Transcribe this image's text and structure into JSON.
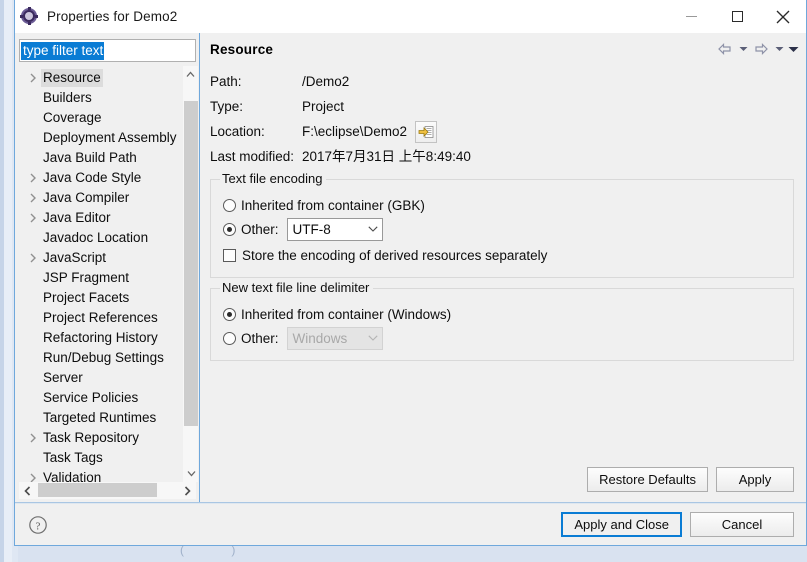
{
  "window": {
    "title": "Properties for Demo2",
    "icon": "properties-gear-icon",
    "controls": {
      "minimize": "minimize-icon",
      "maximize": "maximize-icon",
      "close": "close-icon"
    }
  },
  "background": {
    "faint_text": "( )"
  },
  "filter": {
    "value": "type filter text",
    "placeholder": "type filter text",
    "selected": true,
    "selection_color": "#0a7cd4"
  },
  "tree": {
    "selected": "Resource",
    "items": [
      {
        "label": "Resource",
        "expandable": true,
        "selected": true
      },
      {
        "label": "Builders",
        "expandable": false,
        "selected": false
      },
      {
        "label": "Coverage",
        "expandable": false,
        "selected": false
      },
      {
        "label": "Deployment Assembly",
        "expandable": false,
        "selected": false
      },
      {
        "label": "Java Build Path",
        "expandable": false,
        "selected": false
      },
      {
        "label": "Java Code Style",
        "expandable": true,
        "selected": false
      },
      {
        "label": "Java Compiler",
        "expandable": true,
        "selected": false
      },
      {
        "label": "Java Editor",
        "expandable": true,
        "selected": false
      },
      {
        "label": "Javadoc Location",
        "expandable": false,
        "selected": false
      },
      {
        "label": "JavaScript",
        "expandable": true,
        "selected": false
      },
      {
        "label": "JSP Fragment",
        "expandable": false,
        "selected": false
      },
      {
        "label": "Project Facets",
        "expandable": false,
        "selected": false
      },
      {
        "label": "Project References",
        "expandable": false,
        "selected": false
      },
      {
        "label": "Refactoring History",
        "expandable": false,
        "selected": false
      },
      {
        "label": "Run/Debug Settings",
        "expandable": false,
        "selected": false
      },
      {
        "label": "Server",
        "expandable": false,
        "selected": false
      },
      {
        "label": "Service Policies",
        "expandable": false,
        "selected": false
      },
      {
        "label": "Targeted Runtimes",
        "expandable": false,
        "selected": false
      },
      {
        "label": "Task Repository",
        "expandable": true,
        "selected": false
      },
      {
        "label": "Task Tags",
        "expandable": false,
        "selected": false
      },
      {
        "label": "Validation",
        "expandable": true,
        "selected": false
      }
    ]
  },
  "page": {
    "title": "Resource",
    "nav": {
      "back": "back-arrow-icon",
      "back_menu": "chevron-down-icon",
      "forward": "forward-arrow-icon",
      "forward_menu": "chevron-down-icon",
      "view_menu": "chevron-down-icon"
    },
    "info": [
      {
        "label": "Path:",
        "value": "/Demo2"
      },
      {
        "label": "Type:",
        "value": "Project"
      },
      {
        "label": "Location:",
        "value": "F:\\eclipse\\Demo2"
      },
      {
        "label": "Last modified:",
        "value": "2017年7月31日 上午8:49:40"
      }
    ],
    "location_button_icon": "open-location-icon",
    "encoding_group": {
      "title": "Text file encoding",
      "inherited_label": "Inherited from container (GBK)",
      "inherited_selected": false,
      "other_label": "Other:",
      "other_selected": true,
      "other_value": "UTF-8",
      "store_derived_label": "Store the encoding of derived resources separately",
      "store_derived_checked": false
    },
    "delimiter_group": {
      "title": "New text file line delimiter",
      "inherited_label": "Inherited from container (Windows)",
      "inherited_selected": true,
      "other_label": "Other:",
      "other_selected": false,
      "other_value": "Windows",
      "other_disabled": true
    },
    "buttons": {
      "restore_defaults": "Restore Defaults",
      "apply": "Apply"
    }
  },
  "footer": {
    "help_icon": "help-question-icon",
    "apply_and_close": "Apply and Close",
    "cancel": "Cancel",
    "focused_button": "Apply and Close",
    "focus_color": "#0a7cd4"
  }
}
